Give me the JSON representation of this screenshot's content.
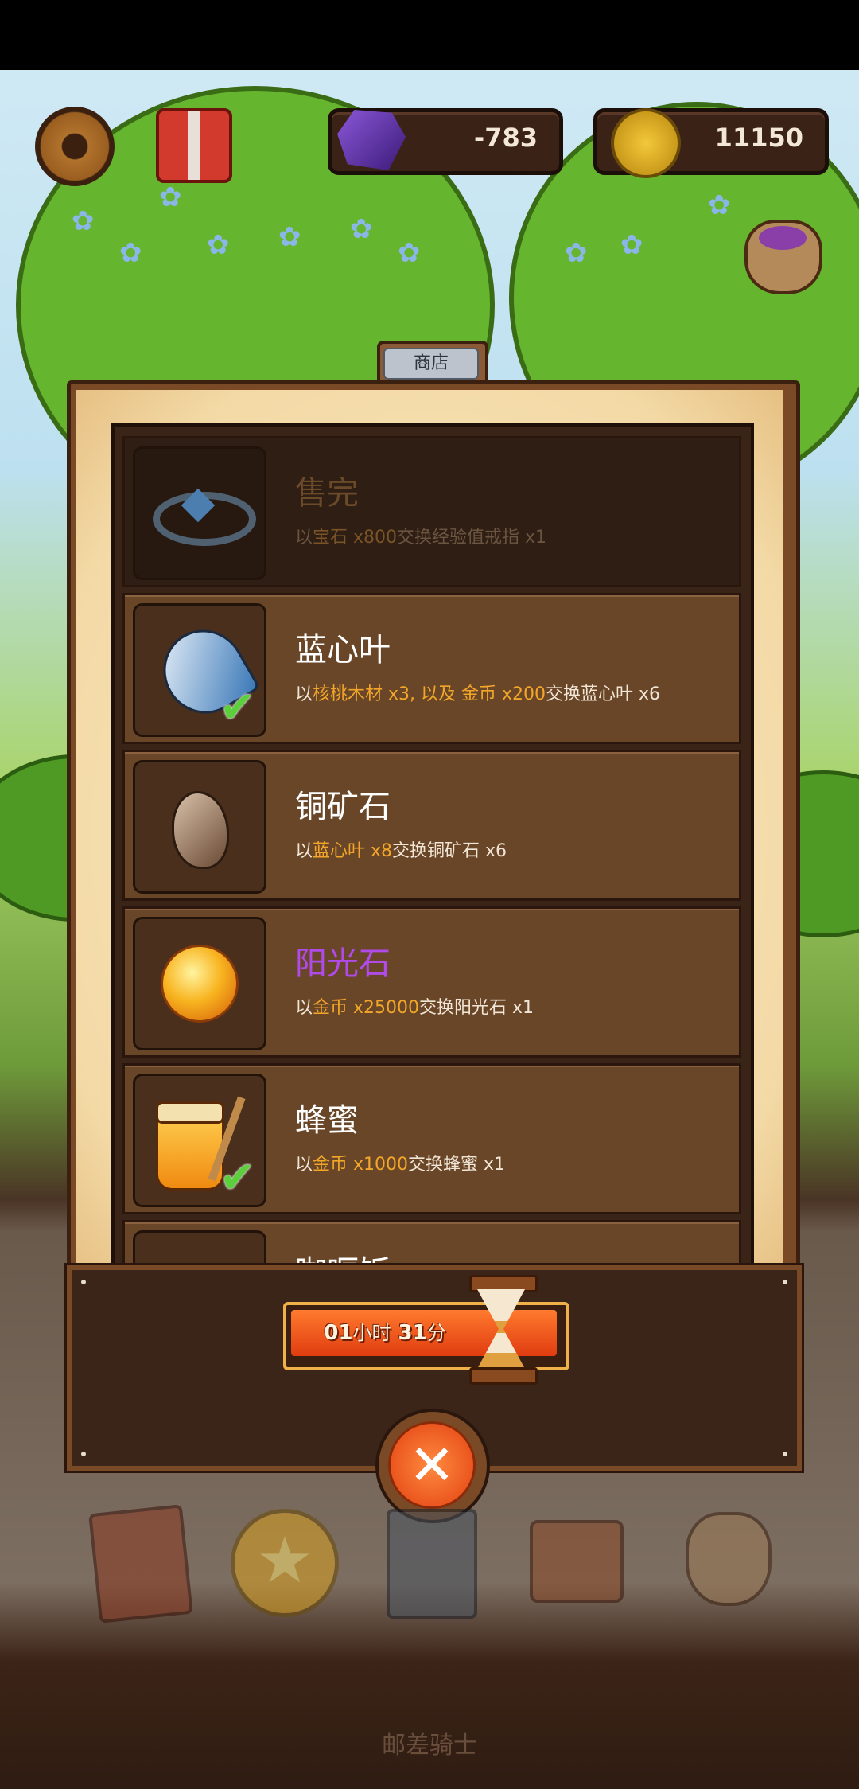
{
  "hud": {
    "settings_icon": "gear-icon",
    "gift_icon": "gift-icon",
    "gems": "-783",
    "coins": "11150",
    "loot_icon": "loot-bag-icon"
  },
  "shop": {
    "tab_label": "商店",
    "items": [
      {
        "name": "售完",
        "desc_parts": [
          "以",
          "宝石 x800",
          "交换经验值戒指 x1"
        ],
        "icon": "ring-icon",
        "sold_out": true,
        "owned_check": false,
        "name_color": "#6b4a2a"
      },
      {
        "name": "蓝心叶",
        "desc_parts": [
          "以",
          "核桃木材 x3, 以及 金币 x200",
          "交换蓝心叶 x6"
        ],
        "icon": "blue-heart-leaf-icon",
        "sold_out": false,
        "owned_check": true,
        "name_color": "#ffffff"
      },
      {
        "name": "铜矿石",
        "desc_parts": [
          "以",
          "蓝心叶 x8",
          "交换铜矿石 x6"
        ],
        "icon": "copper-ore-icon",
        "sold_out": false,
        "owned_check": false,
        "name_color": "#ffffff"
      },
      {
        "name": "阳光石",
        "desc_parts": [
          "以",
          "金币 x25000",
          "交换阳光石 x1"
        ],
        "icon": "sunstone-icon",
        "sold_out": false,
        "owned_check": false,
        "name_color": "#b04ae8"
      },
      {
        "name": "蜂蜜",
        "desc_parts": [
          "以",
          "金币 x1000",
          "交换蜂蜜 x1"
        ],
        "icon": "honey-jar-icon",
        "sold_out": false,
        "owned_check": true,
        "name_color": "#ffffff"
      },
      {
        "name": "咖喱饭",
        "desc_parts": [
          "",
          "",
          ""
        ],
        "icon": "curry-icon",
        "sold_out": false,
        "owned_check": false,
        "name_color": "#ffffff"
      }
    ]
  },
  "timer": {
    "hours": "01",
    "hours_unit": "小时",
    "minutes": "31",
    "minutes_unit": "分",
    "icon": "hourglass-icon"
  },
  "close_icon": "close-icon",
  "nav": [
    "book-icon",
    "star-coin-icon",
    "card-deck-icon",
    "crafting-icon",
    "treasure-bag-icon"
  ],
  "footer_title": "邮差骑士"
}
